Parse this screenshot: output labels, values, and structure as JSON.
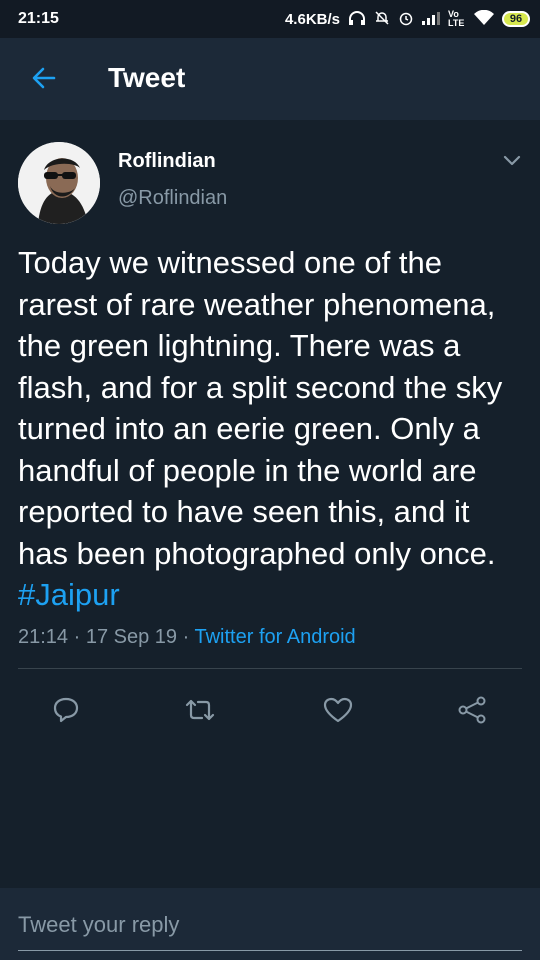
{
  "status_bar": {
    "time": "21:15",
    "network_speed": "4.6KB/s",
    "network_type": "Vo LTE",
    "battery": "96",
    "icons": [
      "headphone-icon",
      "notifications-off-icon",
      "alarm-icon",
      "signal-icon",
      "volte-icon",
      "wifi-icon",
      "battery-icon"
    ]
  },
  "app_bar": {
    "title": "Tweet",
    "back_icon": "back-arrow-icon"
  },
  "tweet": {
    "author_name": "Roflindian",
    "author_handle": "@Roflindian",
    "text": "Today we witnessed one of the rarest of rare weather phenomena, the green lightning. There was a flash, and for a split second the sky turned into an eerie green. Only a handful of people in the world are reported to have seen this, and it has been photographed only once. ",
    "hashtag": "#Jaipur",
    "time": "21:14",
    "date": "17 Sep 19",
    "source": "Twitter for Android",
    "separator": "·"
  },
  "actions": {
    "icons": [
      "reply-icon",
      "retweet-icon",
      "like-icon",
      "share-icon"
    ]
  },
  "reply": {
    "placeholder": "Tweet your reply"
  },
  "colors": {
    "background": "#15202b",
    "app_bar": "#1c2938",
    "accent": "#1da1f2",
    "secondary_text": "#8899a6",
    "divider": "#38444d"
  }
}
